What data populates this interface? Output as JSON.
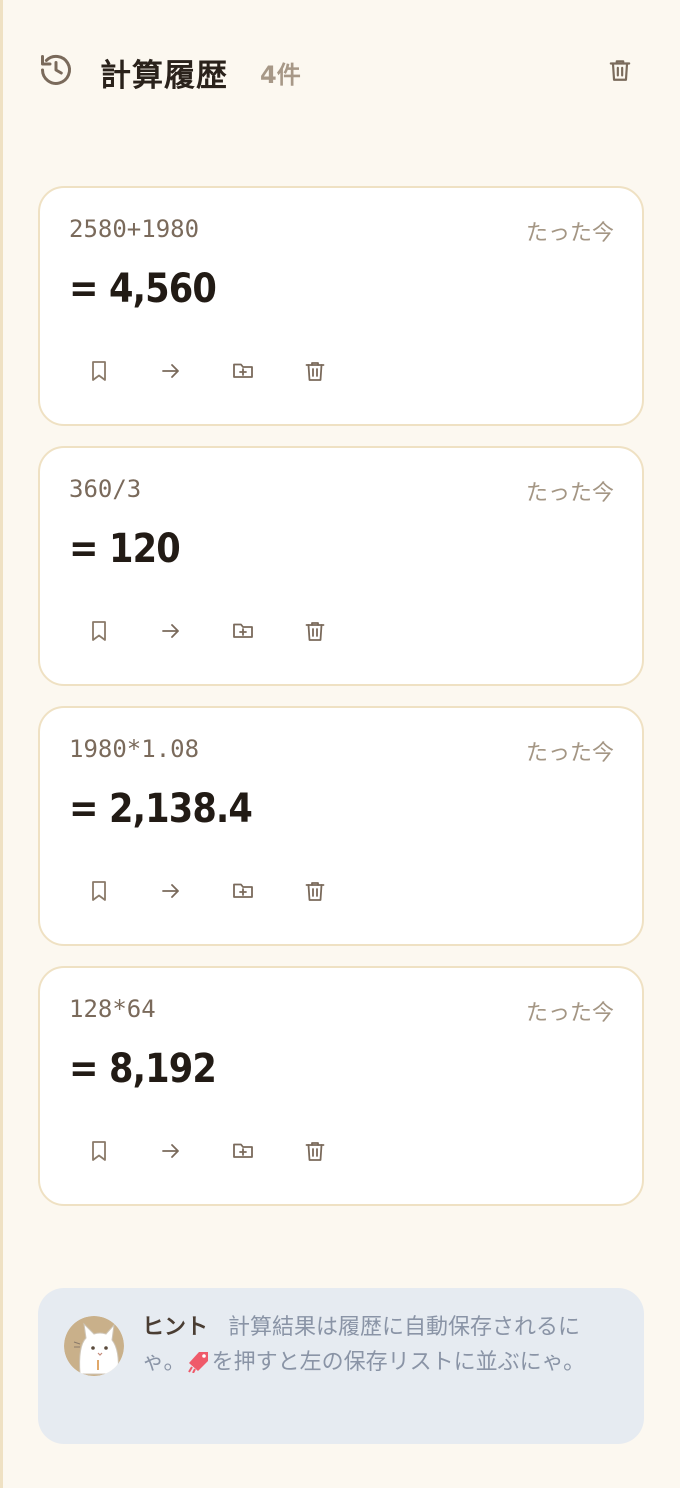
{
  "header": {
    "title": "計算履歴",
    "count": "4件",
    "history_icon": "history-clock-icon",
    "clear_icon": "trash-icon"
  },
  "history": [
    {
      "expression": "2580+1980",
      "time": "たった今",
      "result": "= 4,560"
    },
    {
      "expression": "360/3",
      "time": "たった今",
      "result": "= 120"
    },
    {
      "expression": "1980*1.08",
      "time": "たった今",
      "result": "= 2,138.4"
    },
    {
      "expression": "128*64",
      "time": "たった今",
      "result": "= 8,192"
    }
  ],
  "card_actions": [
    "bookmark-icon",
    "arrow-right-icon",
    "folder-plus-icon",
    "trash-icon"
  ],
  "hint": {
    "label": "ヒント",
    "text_before": "計算結果は履歴に自動保存されるにゃ。",
    "tag_emoji": "🔖",
    "text_after": "を押すと左の保存リストに並ぶにゃ。"
  },
  "colors": {
    "background": "#fcf8f0",
    "card_border": "#efe1c3",
    "hint_bg": "#e6ebf1",
    "icon": "#7a6a5b"
  }
}
